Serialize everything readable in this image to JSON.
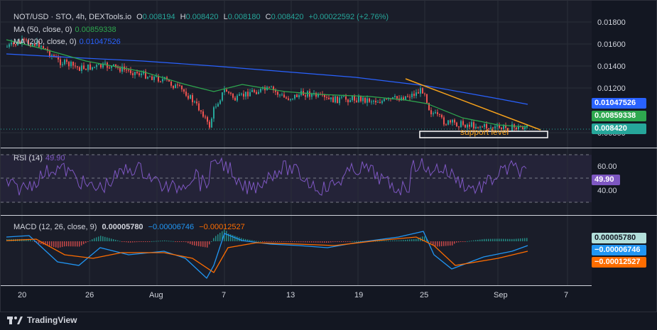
{
  "header": {
    "symbol": "NOT/USD · STO, 4h, DEXTools.io",
    "o_label": "O",
    "o_value": "0.008194",
    "h_label": "H",
    "h_value": "0.008420",
    "l_label": "L",
    "l_value": "0.008180",
    "c_label": "C",
    "c_value": "0.008420",
    "change": "+0.00022592 (+2.76%)"
  },
  "ma50": {
    "label": "MA (50, close, 0)",
    "value": "0.00859338",
    "color": "#2ea84f"
  },
  "ma200": {
    "label": "MA (200, close, 0)",
    "value": "0.01047526",
    "color": "#2962ff"
  },
  "price_axis": {
    "ticks": [
      "0.01800",
      "0.01600",
      "0.01400",
      "0.01200",
      "0.00800"
    ],
    "badges": {
      "ma200": "0.01047526",
      "ma50": "0.00859338",
      "last": "0.008420"
    }
  },
  "annotation": {
    "support_label": "support level"
  },
  "rsi": {
    "label": "RSI (14)",
    "value": "49.90",
    "color": "#7e57c2",
    "ticks": [
      "60.00",
      "40.00"
    ],
    "badge": "49.90"
  },
  "macd": {
    "label": "MACD (12, 26, close, 9)",
    "hist": "0.00005780",
    "macd": "−0.00006746",
    "signal": "−0.00012527",
    "badges": {
      "hist": "0.00005780",
      "macd": "−0.00006746",
      "signal": "−0.00012527"
    }
  },
  "time_axis": [
    "20",
    "26",
    "Aug",
    "7",
    "13",
    "19",
    "25",
    "Sep",
    "7"
  ],
  "footer": {
    "brand": "TradingView"
  },
  "colors": {
    "up": "#26a69a",
    "down": "#ef5350",
    "trend": "#f7a21b",
    "macd": "#2196f3",
    "signal": "#ff6d00"
  }
}
